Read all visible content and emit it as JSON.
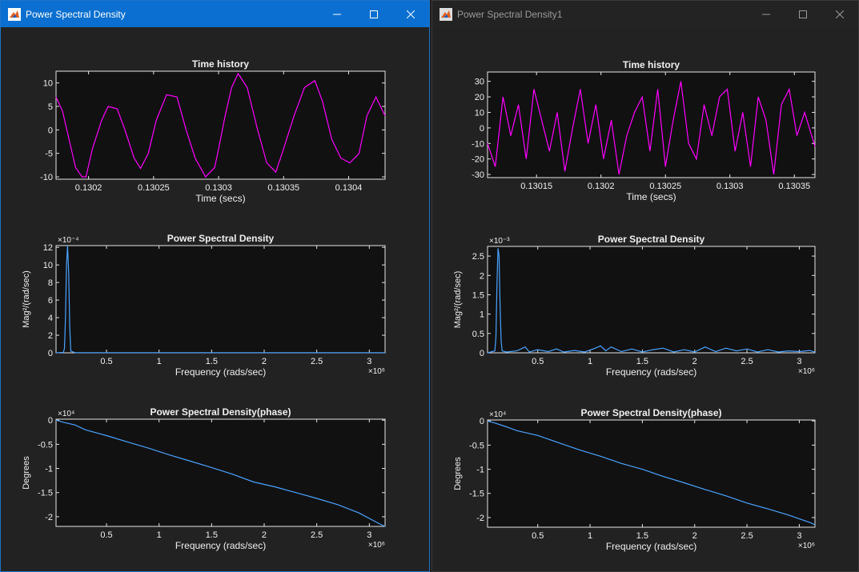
{
  "windows": [
    {
      "title": "Power Spectral Density",
      "active": true,
      "plots": [
        {
          "title": "Time history",
          "xlabel": "Time (secs)",
          "ylabel": "",
          "type": "line",
          "series_color": "#ff00ff",
          "xlim": [
            0.130175,
            0.130428
          ],
          "ylim": [
            -10.5,
            12.5
          ],
          "xticks": [
            {
              "v": 0.1302,
              "label": "0.1302"
            },
            {
              "v": 0.13025,
              "label": "0.13025"
            },
            {
              "v": 0.1303,
              "label": "0.1303"
            },
            {
              "v": 0.13035,
              "label": "0.13035"
            },
            {
              "v": 0.1304,
              "label": "0.1304"
            }
          ],
          "yticks": [
            {
              "v": 10,
              "label": "10"
            },
            {
              "v": 5,
              "label": "5"
            },
            {
              "v": 0,
              "label": "0"
            },
            {
              "v": -5,
              "label": "-5"
            },
            {
              "v": -10,
              "label": "-10"
            }
          ],
          "xmult": "",
          "ymult": "",
          "x": [
            0.130175,
            0.13018,
            0.130185,
            0.13019,
            0.130195,
            0.130198,
            0.130203,
            0.13021,
            0.130215,
            0.130222,
            0.130228,
            0.130235,
            0.13024,
            0.130246,
            0.130252,
            0.13026,
            0.130268,
            0.130275,
            0.130282,
            0.13029,
            0.130297,
            0.1303,
            0.130305,
            0.13031,
            0.130315,
            0.130322,
            0.13033,
            0.130337,
            0.130344,
            0.13035,
            0.130358,
            0.130366,
            0.130374,
            0.13038,
            0.130387,
            0.130394,
            0.130401,
            0.130408,
            0.130414,
            0.130421,
            0.130428
          ],
          "y": [
            7,
            4,
            -2,
            -8,
            -10,
            -10,
            -4,
            2,
            5,
            4.5,
            0,
            -6,
            -8.2,
            -5,
            2,
            7.5,
            7,
            0,
            -6,
            -10,
            -8,
            -4,
            3,
            9,
            12,
            9,
            0,
            -7,
            -9,
            -4,
            3,
            9,
            10.5,
            6,
            -2,
            -6,
            -7,
            -5,
            3,
            7,
            3
          ]
        },
        {
          "title": "Power Spectral Density",
          "xlabel": "Frequency (rads/sec)",
          "ylabel": "Mag²/(rad/sec)",
          "type": "line",
          "series_color": "#4aa3ff",
          "xlim": [
            0.02,
            3.15
          ],
          "ylim": [
            0,
            12.2
          ],
          "xticks": [
            {
              "v": 0.5,
              "label": "0.5"
            },
            {
              "v": 1,
              "label": "1"
            },
            {
              "v": 1.5,
              "label": "1.5"
            },
            {
              "v": 2,
              "label": "2"
            },
            {
              "v": 2.5,
              "label": "2.5"
            },
            {
              "v": 3,
              "label": "3"
            }
          ],
          "yticks": [
            {
              "v": 12,
              "label": "12"
            },
            {
              "v": 10,
              "label": "10"
            },
            {
              "v": 8,
              "label": "8"
            },
            {
              "v": 6,
              "label": "6"
            },
            {
              "v": 4,
              "label": "4"
            },
            {
              "v": 2,
              "label": "2"
            },
            {
              "v": 0,
              "label": "0"
            }
          ],
          "xmult": "×10⁶",
          "ymult": "×10⁻⁴",
          "x": [
            0.02,
            0.09,
            0.1,
            0.11,
            0.12,
            0.13,
            0.14,
            0.15,
            0.16,
            0.2,
            1,
            2,
            3.15
          ],
          "y": [
            0,
            0.05,
            0.5,
            4,
            10,
            12.2,
            9,
            3,
            0.2,
            0.02,
            0.02,
            0.02,
            0.02
          ]
        },
        {
          "title": "Power Spectral Density(phase)",
          "xlabel": "Frequency (rads/sec)",
          "ylabel": "Degrees",
          "type": "line",
          "series_color": "#4aa3ff",
          "xlim": [
            0.02,
            3.15
          ],
          "ylim": [
            -2.2,
            0.02
          ],
          "xticks": [
            {
              "v": 0.5,
              "label": "0.5"
            },
            {
              "v": 1,
              "label": "1"
            },
            {
              "v": 1.5,
              "label": "1.5"
            },
            {
              "v": 2,
              "label": "2"
            },
            {
              "v": 2.5,
              "label": "2.5"
            },
            {
              "v": 3,
              "label": "3"
            }
          ],
          "yticks": [
            {
              "v": 0,
              "label": "0"
            },
            {
              "v": -0.5,
              "label": "-0.5"
            },
            {
              "v": -1,
              "label": "-1"
            },
            {
              "v": -1.5,
              "label": "-1.5"
            },
            {
              "v": -2,
              "label": "-2"
            }
          ],
          "xmult": "×10⁶",
          "ymult": "×10⁴",
          "x": [
            0.02,
            0.1,
            0.2,
            0.3,
            0.5,
            0.7,
            0.9,
            1.1,
            1.3,
            1.5,
            1.7,
            1.9,
            2.1,
            2.3,
            2.5,
            2.7,
            2.9,
            3.1,
            3.15
          ],
          "y": [
            0,
            -0.05,
            -0.1,
            -0.2,
            -0.32,
            -0.45,
            -0.58,
            -0.72,
            -0.85,
            -0.98,
            -1.12,
            -1.28,
            -1.38,
            -1.5,
            -1.62,
            -1.75,
            -1.92,
            -2.15,
            -2.2
          ]
        }
      ]
    },
    {
      "title": "Power Spectral Density1",
      "active": false,
      "plots": [
        {
          "title": "Time history",
          "xlabel": "Time (secs)",
          "ylabel": "",
          "type": "line",
          "series_color": "#ff00ff",
          "xlim": [
            0.130112,
            0.130366
          ],
          "ylim": [
            -32,
            36
          ],
          "xticks": [
            {
              "v": 0.13015,
              "label": "0.13015"
            },
            {
              "v": 0.1302,
              "label": "0.1302"
            },
            {
              "v": 0.13025,
              "label": "0.13025"
            },
            {
              "v": 0.1303,
              "label": "0.1303"
            },
            {
              "v": 0.13035,
              "label": "0.13035"
            }
          ],
          "yticks": [
            {
              "v": 30,
              "label": "30"
            },
            {
              "v": 20,
              "label": "20"
            },
            {
              "v": 10,
              "label": "10"
            },
            {
              "v": 0,
              "label": "0"
            },
            {
              "v": -10,
              "label": "-10"
            },
            {
              "v": -20,
              "label": "-20"
            },
            {
              "v": -30,
              "label": "-30"
            }
          ],
          "xmult": "",
          "ymult": "",
          "x": [
            0.130112,
            0.130118,
            0.130124,
            0.13013,
            0.130136,
            0.130142,
            0.130148,
            0.130154,
            0.13016,
            0.130166,
            0.130172,
            0.130178,
            0.130184,
            0.13019,
            0.130196,
            0.130202,
            0.130208,
            0.130214,
            0.13022,
            0.130226,
            0.130232,
            0.130238,
            0.130244,
            0.13025,
            0.130256,
            0.130262,
            0.130268,
            0.130274,
            0.13028,
            0.130286,
            0.130292,
            0.130298,
            0.130304,
            0.13031,
            0.130316,
            0.130322,
            0.130328,
            0.130334,
            0.13034,
            0.130346,
            0.130352,
            0.130358,
            0.130366
          ],
          "y": [
            -10,
            -25,
            20,
            -5,
            15,
            -20,
            25,
            5,
            -15,
            10,
            -28,
            0,
            25,
            -10,
            15,
            -20,
            5,
            -30,
            -5,
            10,
            20,
            -15,
            25,
            -25,
            5,
            30,
            -10,
            -20,
            15,
            -5,
            20,
            25,
            -15,
            10,
            -25,
            20,
            5,
            -30,
            15,
            25,
            -5,
            10,
            -12
          ]
        },
        {
          "title": "Power Spectral Density",
          "xlabel": "Frequency (rads/sec)",
          "ylabel": "Mag²/(rad/sec)",
          "type": "line",
          "series_color": "#4aa3ff",
          "xlim": [
            0.02,
            3.15
          ],
          "ylim": [
            0,
            2.75
          ],
          "xticks": [
            {
              "v": 0.5,
              "label": "0.5"
            },
            {
              "v": 1,
              "label": "1"
            },
            {
              "v": 1.5,
              "label": "1.5"
            },
            {
              "v": 2,
              "label": "2"
            },
            {
              "v": 2.5,
              "label": "2.5"
            },
            {
              "v": 3,
              "label": "3"
            }
          ],
          "yticks": [
            {
              "v": 2.5,
              "label": "2.5"
            },
            {
              "v": 2,
              "label": "2"
            },
            {
              "v": 1.5,
              "label": "1.5"
            },
            {
              "v": 1,
              "label": "1"
            },
            {
              "v": 0.5,
              "label": "0.5"
            },
            {
              "v": 0,
              "label": "0"
            }
          ],
          "xmult": "×10⁶",
          "ymult": "×10⁻³",
          "x": [
            0.02,
            0.09,
            0.1,
            0.11,
            0.12,
            0.13,
            0.14,
            0.15,
            0.16,
            0.2,
            0.3,
            0.38,
            0.42,
            0.5,
            0.6,
            0.68,
            0.75,
            0.85,
            0.95,
            1.05,
            1.1,
            1.15,
            1.2,
            1.3,
            1.4,
            1.5,
            1.6,
            1.7,
            1.8,
            1.9,
            2.0,
            2.1,
            2.2,
            2.3,
            2.4,
            2.5,
            2.6,
            2.7,
            2.8,
            2.9,
            3.0,
            3.1,
            3.15
          ],
          "y": [
            0,
            0.05,
            0.4,
            1.8,
            2.7,
            2.5,
            1.2,
            0.3,
            0.05,
            0.02,
            0.05,
            0.15,
            0.02,
            0.08,
            0.03,
            0.1,
            0.02,
            0.06,
            0.02,
            0.12,
            0.18,
            0.05,
            0.15,
            0.03,
            0.1,
            0.02,
            0.08,
            0.12,
            0.02,
            0.08,
            0.02,
            0.15,
            0.03,
            0.12,
            0.05,
            0.1,
            0.02,
            0.08,
            0.02,
            0.05,
            0.03,
            0.06,
            0.02
          ]
        },
        {
          "title": "Power Spectral Density(phase)",
          "xlabel": "Frequency (rads/sec)",
          "ylabel": "Degrees",
          "type": "line",
          "series_color": "#4aa3ff",
          "xlim": [
            0.02,
            3.15
          ],
          "ylim": [
            -2.2,
            0.02
          ],
          "xticks": [
            {
              "v": 0.5,
              "label": "0.5"
            },
            {
              "v": 1,
              "label": "1"
            },
            {
              "v": 1.5,
              "label": "1.5"
            },
            {
              "v": 2,
              "label": "2"
            },
            {
              "v": 2.5,
              "label": "2.5"
            },
            {
              "v": 3,
              "label": "3"
            }
          ],
          "yticks": [
            {
              "v": 0,
              "label": "0"
            },
            {
              "v": -0.5,
              "label": "-0.5"
            },
            {
              "v": -1,
              "label": "-1"
            },
            {
              "v": -1.5,
              "label": "-1.5"
            },
            {
              "v": -2,
              "label": "-2"
            }
          ],
          "xmult": "×10⁶",
          "ymult": "×10⁴",
          "x": [
            0.02,
            0.1,
            0.2,
            0.3,
            0.5,
            0.7,
            0.9,
            1.1,
            1.3,
            1.5,
            1.7,
            1.9,
            2.1,
            2.3,
            2.5,
            2.7,
            2.9,
            3.1,
            3.15
          ],
          "y": [
            0,
            -0.05,
            -0.12,
            -0.2,
            -0.3,
            -0.45,
            -0.6,
            -0.73,
            -0.88,
            -1.0,
            -1.15,
            -1.28,
            -1.42,
            -1.55,
            -1.7,
            -1.82,
            -1.95,
            -2.1,
            -2.15
          ]
        }
      ]
    }
  ],
  "chart_data": [
    {
      "type": "line",
      "title": "Time history",
      "xlabel": "Time (secs)",
      "window": "Power Spectral Density"
    },
    {
      "type": "line",
      "title": "Power Spectral Density",
      "xlabel": "Frequency (rads/sec)",
      "ylabel": "Mag²/(rad/sec)",
      "window": "Power Spectral Density"
    },
    {
      "type": "line",
      "title": "Power Spectral Density(phase)",
      "xlabel": "Frequency (rads/sec)",
      "ylabel": "Degrees",
      "window": "Power Spectral Density"
    },
    {
      "type": "line",
      "title": "Time history",
      "xlabel": "Time (secs)",
      "window": "Power Spectral Density1"
    },
    {
      "type": "line",
      "title": "Power Spectral Density",
      "xlabel": "Frequency (rads/sec)",
      "ylabel": "Mag²/(rad/sec)",
      "window": "Power Spectral Density1"
    },
    {
      "type": "line",
      "title": "Power Spectral Density(phase)",
      "xlabel": "Frequency (rads/sec)",
      "ylabel": "Degrees",
      "window": "Power Spectral Density1"
    }
  ]
}
